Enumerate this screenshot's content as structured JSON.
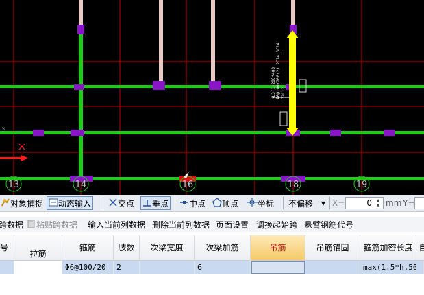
{
  "canvas": {
    "axis_labels": [
      "13",
      "14",
      "16",
      "18",
      "19"
    ],
    "beam_annotation_lines": [
      "KL3(1)200*400",
      "Φ6@100/200(2) 2C14;3C14",
      "G2C12"
    ]
  },
  "toolbar": {
    "object_snap": "对象捕捉",
    "dynamic_input": "动态输入",
    "intersection": "交点",
    "perpendicular": "垂点",
    "midpoint": "中点",
    "vertex": "顶点",
    "coordinate": "坐标",
    "no_offset": "不偏移",
    "x_label": "X=",
    "x_value": "0",
    "x_unit": "mm",
    "y_label": "Y="
  },
  "grid_toolbar": {
    "copy_span_data": "跨数据",
    "paste_span_data": "粘贴跨数据",
    "input_current_col": "输入当前列数据",
    "delete_current_col": "删除当前列数据",
    "page_setup": "页面设置",
    "adjust_start_span": "调换起始跨",
    "cantilever_code": "悬臂钢筋代号"
  },
  "table": {
    "columns": [
      "号",
      "拉筋",
      "箍筋",
      "肢数",
      "次梁宽度",
      "次梁加筋",
      "吊筋",
      "吊筋锚固",
      "箍筋加密长度",
      "自"
    ],
    "row": [
      "",
      "",
      "Φ6@100/20",
      "2",
      "",
      "6",
      "",
      "",
      "max(1.5*h,50",
      ""
    ]
  },
  "colors": {
    "beam_green": "#22c81e",
    "axis_red": "#c80000",
    "highlight_yellow": "#ffff00",
    "node_purple": "#8a14c8",
    "selected_header": "#f6c968"
  },
  "icons": [
    "snap-icon",
    "dynamic-input-icon",
    "intersection-icon",
    "perpendicular-icon",
    "midpoint-icon",
    "vertex-icon",
    "coordinate-icon",
    "dropdown-icon",
    "paste-icon"
  ]
}
